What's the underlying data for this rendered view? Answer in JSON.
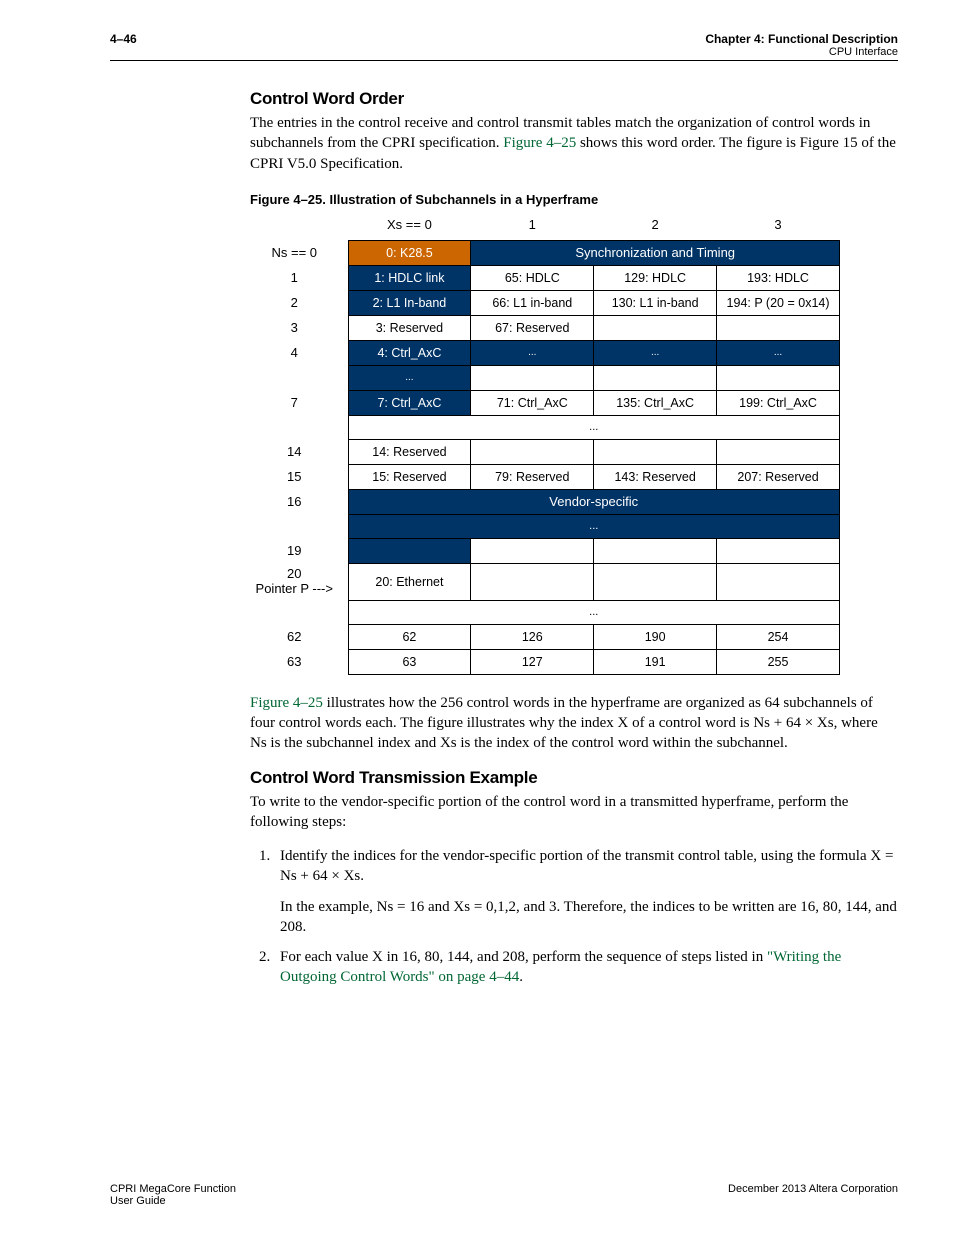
{
  "header": {
    "page_number": "4–46",
    "chapter": "Chapter 4:  Functional Description",
    "section": "CPU Interface"
  },
  "section1": {
    "title": "Control Word Order",
    "para": "The entries in the control receive and control transmit tables match the organization of control words in subchannels from the CPRI specification. ",
    "figref": "Figure 4–25",
    "para_cont": " shows this word order. The figure is Figure 15 of the CPRI V5.0 Specification."
  },
  "figure": {
    "caption": "Figure 4–25.  Illustration of Subchannels in a Hyperframe",
    "col_headers": [
      "Xs == 0",
      "1",
      "2",
      "3"
    ],
    "row_labels": {
      "ns0": "Ns == 0",
      "r1": "1",
      "r2": "2",
      "r3": "3",
      "r4": "4",
      "r7": "7",
      "r14": "14",
      "r15": "15",
      "r16": "16",
      "r19": "19",
      "r20_a": "20",
      "r20_b": "Pointer P --->",
      "r62": "62",
      "r63": "63"
    },
    "cells": {
      "k285": "0: K28.5",
      "sync": "Synchronization and Timing",
      "r1": [
        "1: HDLC link",
        "65: HDLC",
        "129: HDLC",
        "193: HDLC"
      ],
      "r2": [
        "2: L1 In-band",
        "66: L1 in-band",
        "130: L1 in-band",
        "194: P (20 = 0x14)"
      ],
      "r3": [
        "3: Reserved",
        "67: Reserved",
        "",
        ""
      ],
      "r4": [
        "4: Ctrl_AxC",
        "...",
        "...",
        "..."
      ],
      "rblank": [
        "...",
        "",
        "",
        ""
      ],
      "r7": [
        "7: Ctrl_AxC",
        "71: Ctrl_AxC",
        "135: Ctrl_AxC",
        "199: Ctrl_AxC"
      ],
      "ellipsis": "...",
      "r14": [
        "14: Reserved",
        "",
        "",
        ""
      ],
      "r15": [
        "15: Reserved",
        "79: Reserved",
        "143: Reserved",
        "207: Reserved"
      ],
      "r16": "Vendor-specific",
      "r19": [
        "",
        "",
        "",
        ""
      ],
      "r20": [
        "20: Ethernet",
        "",
        "",
        ""
      ],
      "r62": [
        "62",
        "126",
        "190",
        "254"
      ],
      "r63": [
        "63",
        "127",
        "191",
        "255"
      ]
    }
  },
  "section2": {
    "figref": "Figure 4–25",
    "para": " illustrates how the 256 control words in the hyperframe are organized as 64 subchannels of four control words each. The figure illustrates why the index X of a control word is Ns + 64 × Xs, where Ns is the subchannel index and Xs is the index of the control word within the subchannel."
  },
  "section3": {
    "title": "Control Word Transmission Example",
    "intro": "To write to the vendor-specific portion of the control word in a transmitted hyperframe, perform the following steps:",
    "step1a": "Identify the indices for the vendor-specific portion of the transmit control table, using the formula X = Ns + 64 × Xs.",
    "step1b": "In the example, Ns = 16 and Xs = 0,1,2, and 3. Therefore, the indices to be written are 16, 80, 144, and 208.",
    "step2a": "For each value X in 16, 80, 144, and 208, perform the sequence of steps listed in ",
    "step2link": "\"Writing the Outgoing Control Words\" on page 4–44",
    "step2b": "."
  },
  "footer": {
    "left1": "CPRI MegaCore Function",
    "left2": "User Guide",
    "right": "December 2013   Altera Corporation"
  }
}
